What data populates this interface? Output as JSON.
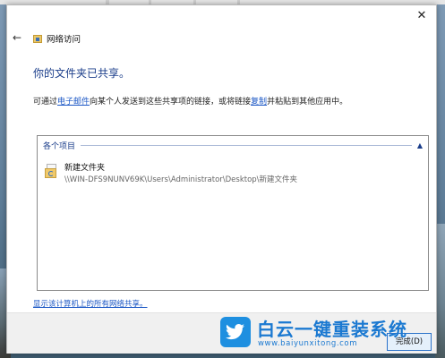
{
  "dialog": {
    "title": "网络访问",
    "close_glyph": "✕",
    "back_glyph": "←"
  },
  "content": {
    "heading": "你的文件夹已共享。",
    "desc_prefix": "可通过",
    "email_link": "电子邮件",
    "desc_middle": "向某个人发送到这些共享项的链接，或将链接",
    "copy_link": "复制",
    "desc_suffix": "并粘贴到其他应用中。"
  },
  "list": {
    "group_label": "各个项目",
    "group_chevron": "▲",
    "items": [
      {
        "name": "新建文件夹",
        "path": "\\\\WIN-DFS9NUNV69K\\Users\\Administrator\\Desktop\\新建文件夹"
      }
    ]
  },
  "footer": {
    "show_all_link": "显示该计算机上的所有网络共享。",
    "finish_label": "完成(D)"
  },
  "watermark": {
    "title": "白云一键重装系统",
    "url": "www.baiyunxitong.com"
  },
  "colors": {
    "accent": "#1b57c5",
    "heading": "#1a3d8a",
    "watermark": "#1b79d1"
  }
}
